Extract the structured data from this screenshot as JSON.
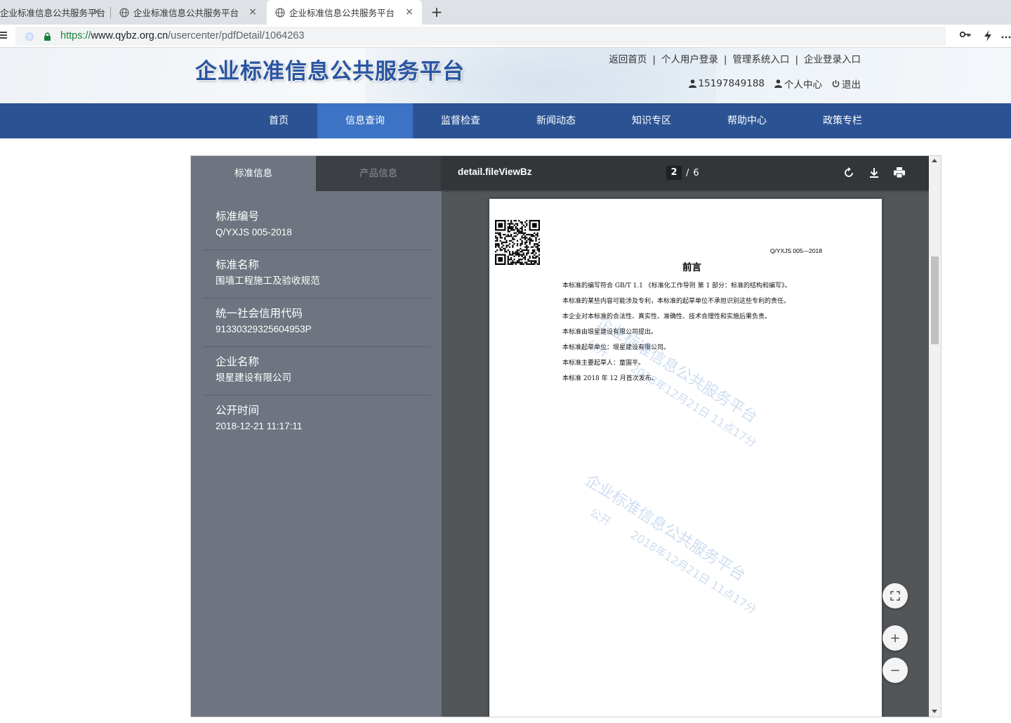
{
  "browser": {
    "tabs": [
      {
        "title": "企业标准信息公共服务平台",
        "close": "×"
      },
      {
        "title": "企业标准信息公共服务平台",
        "close": "×"
      },
      {
        "title": "企业标准信息公共服务平台",
        "close": "×"
      }
    ],
    "new_tab": "+",
    "url": {
      "protocol": "https://",
      "host": "www.qybz.org.cn",
      "path": "/usercenter/pdfDetail/1064263"
    },
    "toolbar_icons": [
      "key-icon",
      "lightning-icon",
      "more-icon"
    ]
  },
  "header": {
    "logo_text": "企业标准信息公共服务平台",
    "top_links": [
      "返回首页",
      "个人用户登录",
      "管理系统入口",
      "企业登录入口"
    ],
    "top_separators": [
      "|",
      "|",
      "|"
    ],
    "user_phone": "15197849188",
    "user_center": "个人中心",
    "logout": "退出"
  },
  "nav": {
    "items": [
      "首页",
      "信息查询",
      "监督检查",
      "新闻动态",
      "知识专区",
      "帮助中心",
      "政策专栏"
    ],
    "active": "信息查询"
  },
  "panel": {
    "tabs": [
      "标准信息",
      "产品信息"
    ],
    "fields": [
      {
        "label": "标准编号",
        "value": "Q/YXJS 005-2018"
      },
      {
        "label": "标准名称",
        "value": "围墙工程施工及验收规范"
      },
      {
        "label": "统一社会信用代码",
        "value": "91330329325604953P"
      },
      {
        "label": "企业名称",
        "value": "垠星建设有限公司"
      },
      {
        "label": "公开时间",
        "value": "2018-12-21 11:17:11"
      }
    ]
  },
  "pdf": {
    "title": "detail.fileViewBz",
    "page_current": "2",
    "page_separator": "/",
    "page_total": "6",
    "tool_icons": [
      "rotate-icon",
      "download-icon",
      "print-icon"
    ],
    "doc_code": "Q/YXJS 005—2018",
    "heading": "前言",
    "lines": [
      "本标准的编写符合 GB/T 1.1 《标准化工作导则 第 1 部分：标准的结构和编写》。",
      "本标准的某些内容可能涉及专利，本标准的起草单位不承担识别这些专利的责任。",
      "本企业对本标准的合法性、真实性、准确性、技术合理性和实施后果负责。",
      "本标准由垠星建设有限公司提出。",
      "本标准起草单位：垠星建设有限公司。",
      "本标准主要起草人：童国平。",
      "本标准 2018 年 12 月首次发布。"
    ],
    "watermark": {
      "main": "企业标准信息公共服务平台",
      "status": "公开",
      "date": "2018年12月21日 11点17分"
    }
  },
  "controls": {
    "fullscreen": "fullscreen-icon",
    "zoom_in": "+",
    "zoom_out": "−"
  },
  "colors": {
    "nav_bg": "#2b5394",
    "nav_active": "#3c73c4",
    "panel_bg": "#6e7580",
    "pdf_toolbar": "#323639",
    "pdf_bg": "#525659",
    "secure_green": "#188038"
  }
}
